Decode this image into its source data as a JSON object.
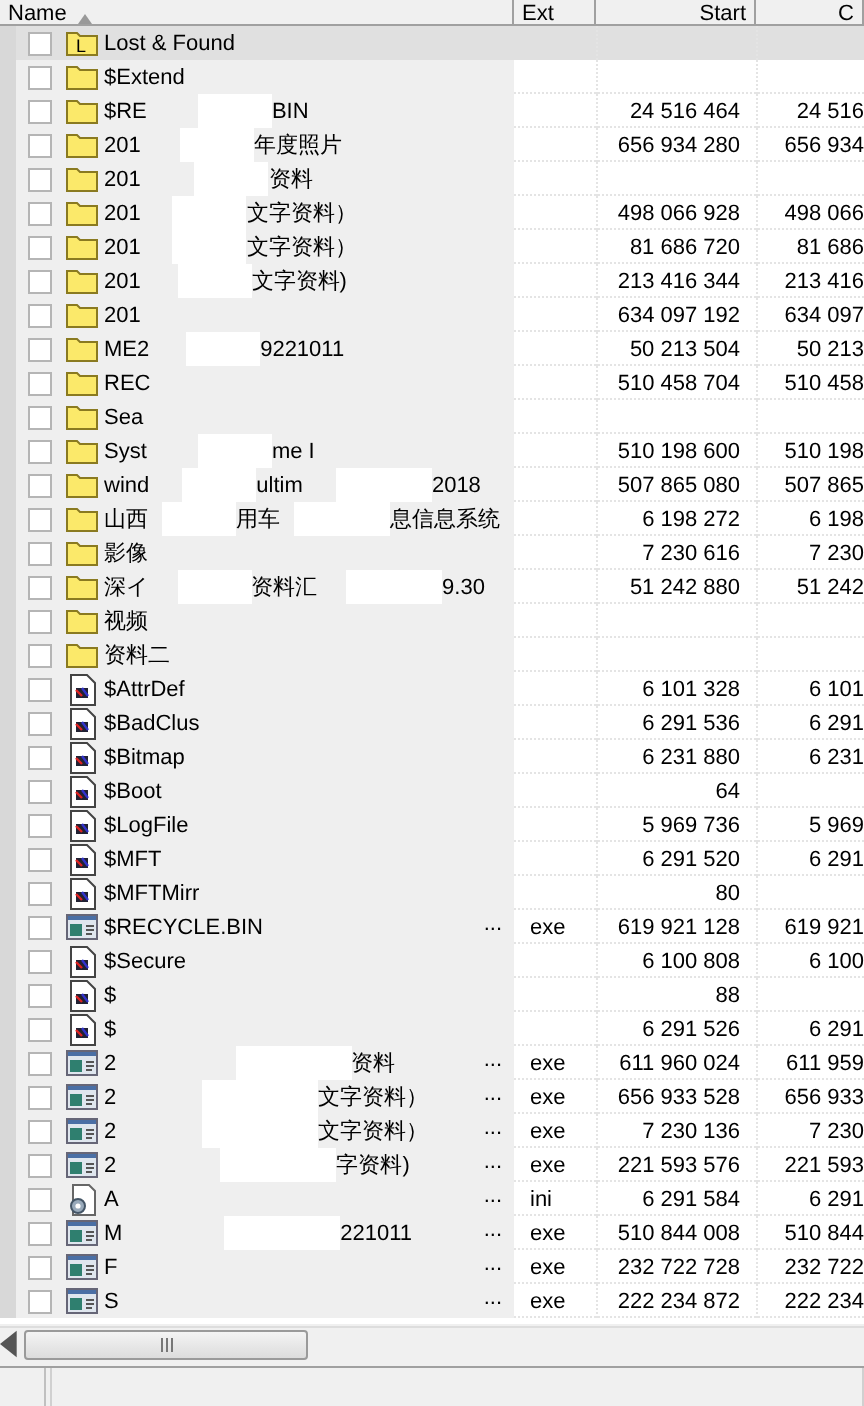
{
  "columns": [
    "Name",
    "Ext",
    "Start",
    "C"
  ],
  "rows": [
    {
      "kind": "folder",
      "badge": "L",
      "name_parts": [
        "Lost & Found"
      ],
      "checked": false,
      "selected": true
    },
    {
      "kind": "folder",
      "name_parts": [
        "$Extend"
      ],
      "checked": false,
      "selected": false
    },
    {
      "kind": "folder",
      "name_parts": [
        "$RE",
        "BIN"
      ],
      "start": "24 516 464",
      "col_4": "24 516",
      "checked": false,
      "selected": false
    },
    {
      "kind": "folder",
      "name_parts": [
        "201",
        "年度照片"
      ],
      "start": "656 934 280",
      "col_4": "656 934",
      "checked": false,
      "selected": false
    },
    {
      "kind": "folder",
      "name_parts": [
        "201",
        "资料"
      ],
      "checked": false,
      "selected": false
    },
    {
      "kind": "folder",
      "name_parts": [
        "201",
        "文字资料）"
      ],
      "start": "498 066 928",
      "col_4": "498 066",
      "checked": false,
      "selected": false
    },
    {
      "kind": "folder",
      "name_parts": [
        "201",
        "文字资料）"
      ],
      "start": "81 686 720",
      "col_4": "81 686",
      "checked": false,
      "selected": false
    },
    {
      "kind": "folder",
      "name_parts": [
        "201",
        "文字资料)"
      ],
      "start": "213 416 344",
      "col_4": "213 416",
      "checked": false,
      "selected": false
    },
    {
      "kind": "folder",
      "name_parts": [
        "201"
      ],
      "start": "634 097 192",
      "col_4": "634 097",
      "checked": false,
      "selected": false
    },
    {
      "kind": "folder",
      "name_parts": [
        "ME2",
        "9221011"
      ],
      "start": "50 213 504",
      "col_4": "50 213",
      "checked": false,
      "selected": false
    },
    {
      "kind": "folder",
      "name_parts": [
        "REC"
      ],
      "start": "510 458 704",
      "col_4": "510 458",
      "checked": false,
      "selected": false
    },
    {
      "kind": "folder",
      "name_parts": [
        "Sea"
      ],
      "checked": false,
      "selected": false
    },
    {
      "kind": "folder",
      "name_parts": [
        "Syst",
        "me I"
      ],
      "start": "510 198 600",
      "col_4": "510 198",
      "checked": false,
      "selected": false
    },
    {
      "kind": "folder",
      "name_parts": [
        "wind",
        "ultim",
        "2018"
      ],
      "start": "507 865 080",
      "col_4": "507 865",
      "checked": false,
      "selected": false
    },
    {
      "kind": "folder",
      "name_parts": [
        "山西",
        "用车",
        "息信息系统"
      ],
      "start": "6 198 272",
      "col_4": "6 198",
      "checked": false,
      "selected": false
    },
    {
      "kind": "folder",
      "name_parts": [
        "影像"
      ],
      "start": "7 230 616",
      "col_4": "7 230",
      "checked": false,
      "selected": false
    },
    {
      "kind": "folder",
      "name_parts": [
        "深イ",
        "资料汇",
        "9.30"
      ],
      "start": "51 242 880",
      "col_4": "51 242",
      "checked": false,
      "selected": false
    },
    {
      "kind": "folder",
      "name_parts": [
        "视频"
      ],
      "checked": false,
      "selected": false
    },
    {
      "kind": "folder",
      "name_parts": [
        "资料二"
      ],
      "checked": false,
      "selected": false
    },
    {
      "kind": "sysfile",
      "name_parts": [
        "$AttrDef"
      ],
      "start": "6 101 328",
      "col_4": "6 101",
      "checked": false,
      "selected": false
    },
    {
      "kind": "sysfile",
      "name_parts": [
        "$BadClus"
      ],
      "start": "6 291 536",
      "col_4": "6 291",
      "checked": false,
      "selected": false
    },
    {
      "kind": "sysfile",
      "name_parts": [
        "$Bitmap"
      ],
      "start": "6 231 880",
      "col_4": "6 231",
      "checked": false,
      "selected": false
    },
    {
      "kind": "sysfile",
      "name_parts": [
        "$Boot"
      ],
      "start": "64",
      "checked": false,
      "selected": false
    },
    {
      "kind": "sysfile",
      "name_parts": [
        "$LogFile"
      ],
      "start": "5 969 736",
      "col_4": "5 969",
      "checked": false,
      "selected": false
    },
    {
      "kind": "sysfile",
      "name_parts": [
        "$MFT"
      ],
      "start": "6 291 520",
      "col_4": "6 291",
      "checked": false,
      "selected": false
    },
    {
      "kind": "sysfile",
      "name_parts": [
        "$MFTMirr"
      ],
      "start": "80",
      "checked": false,
      "selected": false
    },
    {
      "kind": "exe",
      "name_parts": [
        "$RECYCLE.BIN"
      ],
      "more": "...",
      "ext": "exe",
      "start": "619 921 128",
      "col_4": "619 921",
      "checked": false,
      "selected": false
    },
    {
      "kind": "sysfile",
      "name_parts": [
        "$Secure"
      ],
      "start": "6 100 808",
      "col_4": "6 100",
      "checked": false,
      "selected": false
    },
    {
      "kind": "sysfile",
      "name_parts": [
        "$"
      ],
      "start": "88",
      "checked": false,
      "selected": false
    },
    {
      "kind": "sysfile",
      "name_parts": [
        "$"
      ],
      "start": "6 291 526",
      "col_4": "6 291",
      "checked": false,
      "selected": false
    },
    {
      "kind": "exe",
      "name_parts": [
        "2",
        "资料"
      ],
      "more": "...",
      "ext": "exe",
      "start": "611 960 024",
      "col_4": "611 959",
      "checked": false,
      "selected": false
    },
    {
      "kind": "exe",
      "name_parts": [
        "2",
        "文字资料）"
      ],
      "more": "...",
      "ext": "exe",
      "start": "656 933 528",
      "col_4": "656 933",
      "checked": false,
      "selected": false
    },
    {
      "kind": "exe",
      "name_parts": [
        "2",
        "文字资料）"
      ],
      "more": "...",
      "ext": "exe",
      "start": "7 230 136",
      "col_4": "7 230",
      "checked": false,
      "selected": false
    },
    {
      "kind": "exe",
      "name_parts": [
        "2",
        "字资料)"
      ],
      "more": "...",
      "ext": "exe",
      "start": "221 593 576",
      "col_4": "221 593",
      "checked": false,
      "selected": false
    },
    {
      "kind": "config",
      "name_parts": [
        "A"
      ],
      "more": "...",
      "ext": "ini",
      "start": "6 291 584",
      "col_4": "6 291",
      "checked": false,
      "selected": false
    },
    {
      "kind": "exe",
      "name_parts": [
        "M",
        "221011"
      ],
      "more": "...",
      "ext": "exe",
      "start": "510 844 008",
      "col_4": "510 844",
      "checked": false,
      "selected": false
    },
    {
      "kind": "exe",
      "name_parts": [
        "F"
      ],
      "more": "...",
      "ext": "exe",
      "start": "232 722 728",
      "col_4": "232 722",
      "checked": false,
      "selected": false
    },
    {
      "kind": "exe",
      "name_parts": [
        "S"
      ],
      "more": "...",
      "ext": "exe",
      "start": "222 234 872",
      "col_4": "222 234",
      "checked": false,
      "selected": false
    }
  ]
}
